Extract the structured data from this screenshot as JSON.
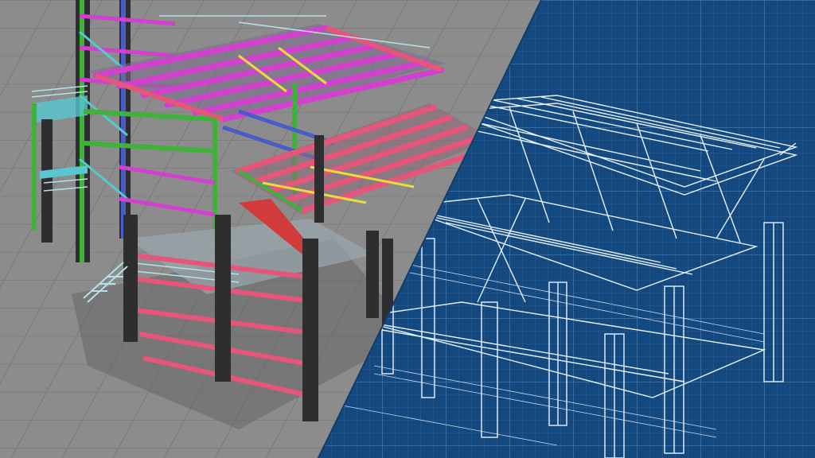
{
  "image": {
    "subject": "structural-steel-frame",
    "left_style": "colored-3d-render",
    "right_style": "blueprint-wireframe"
  },
  "colors": {
    "ground": "#8a8a8a",
    "ground_tile_line": "#7a7a7a",
    "blueprint_bg": "#14497f",
    "blueprint_grid": "#3b6ea3",
    "blueprint_line": "#e8f2ff",
    "beam_magenta": "#d43fd0",
    "beam_pink": "#e8557a",
    "beam_green": "#3fb23a",
    "beam_cyan": "#58c7cf",
    "beam_yellow": "#e8dd3a",
    "beam_blue": "#4a5cc8",
    "column_dark": "#2e2e30",
    "railing": "#b8e0e8",
    "shadow": "#5e5e5e"
  }
}
